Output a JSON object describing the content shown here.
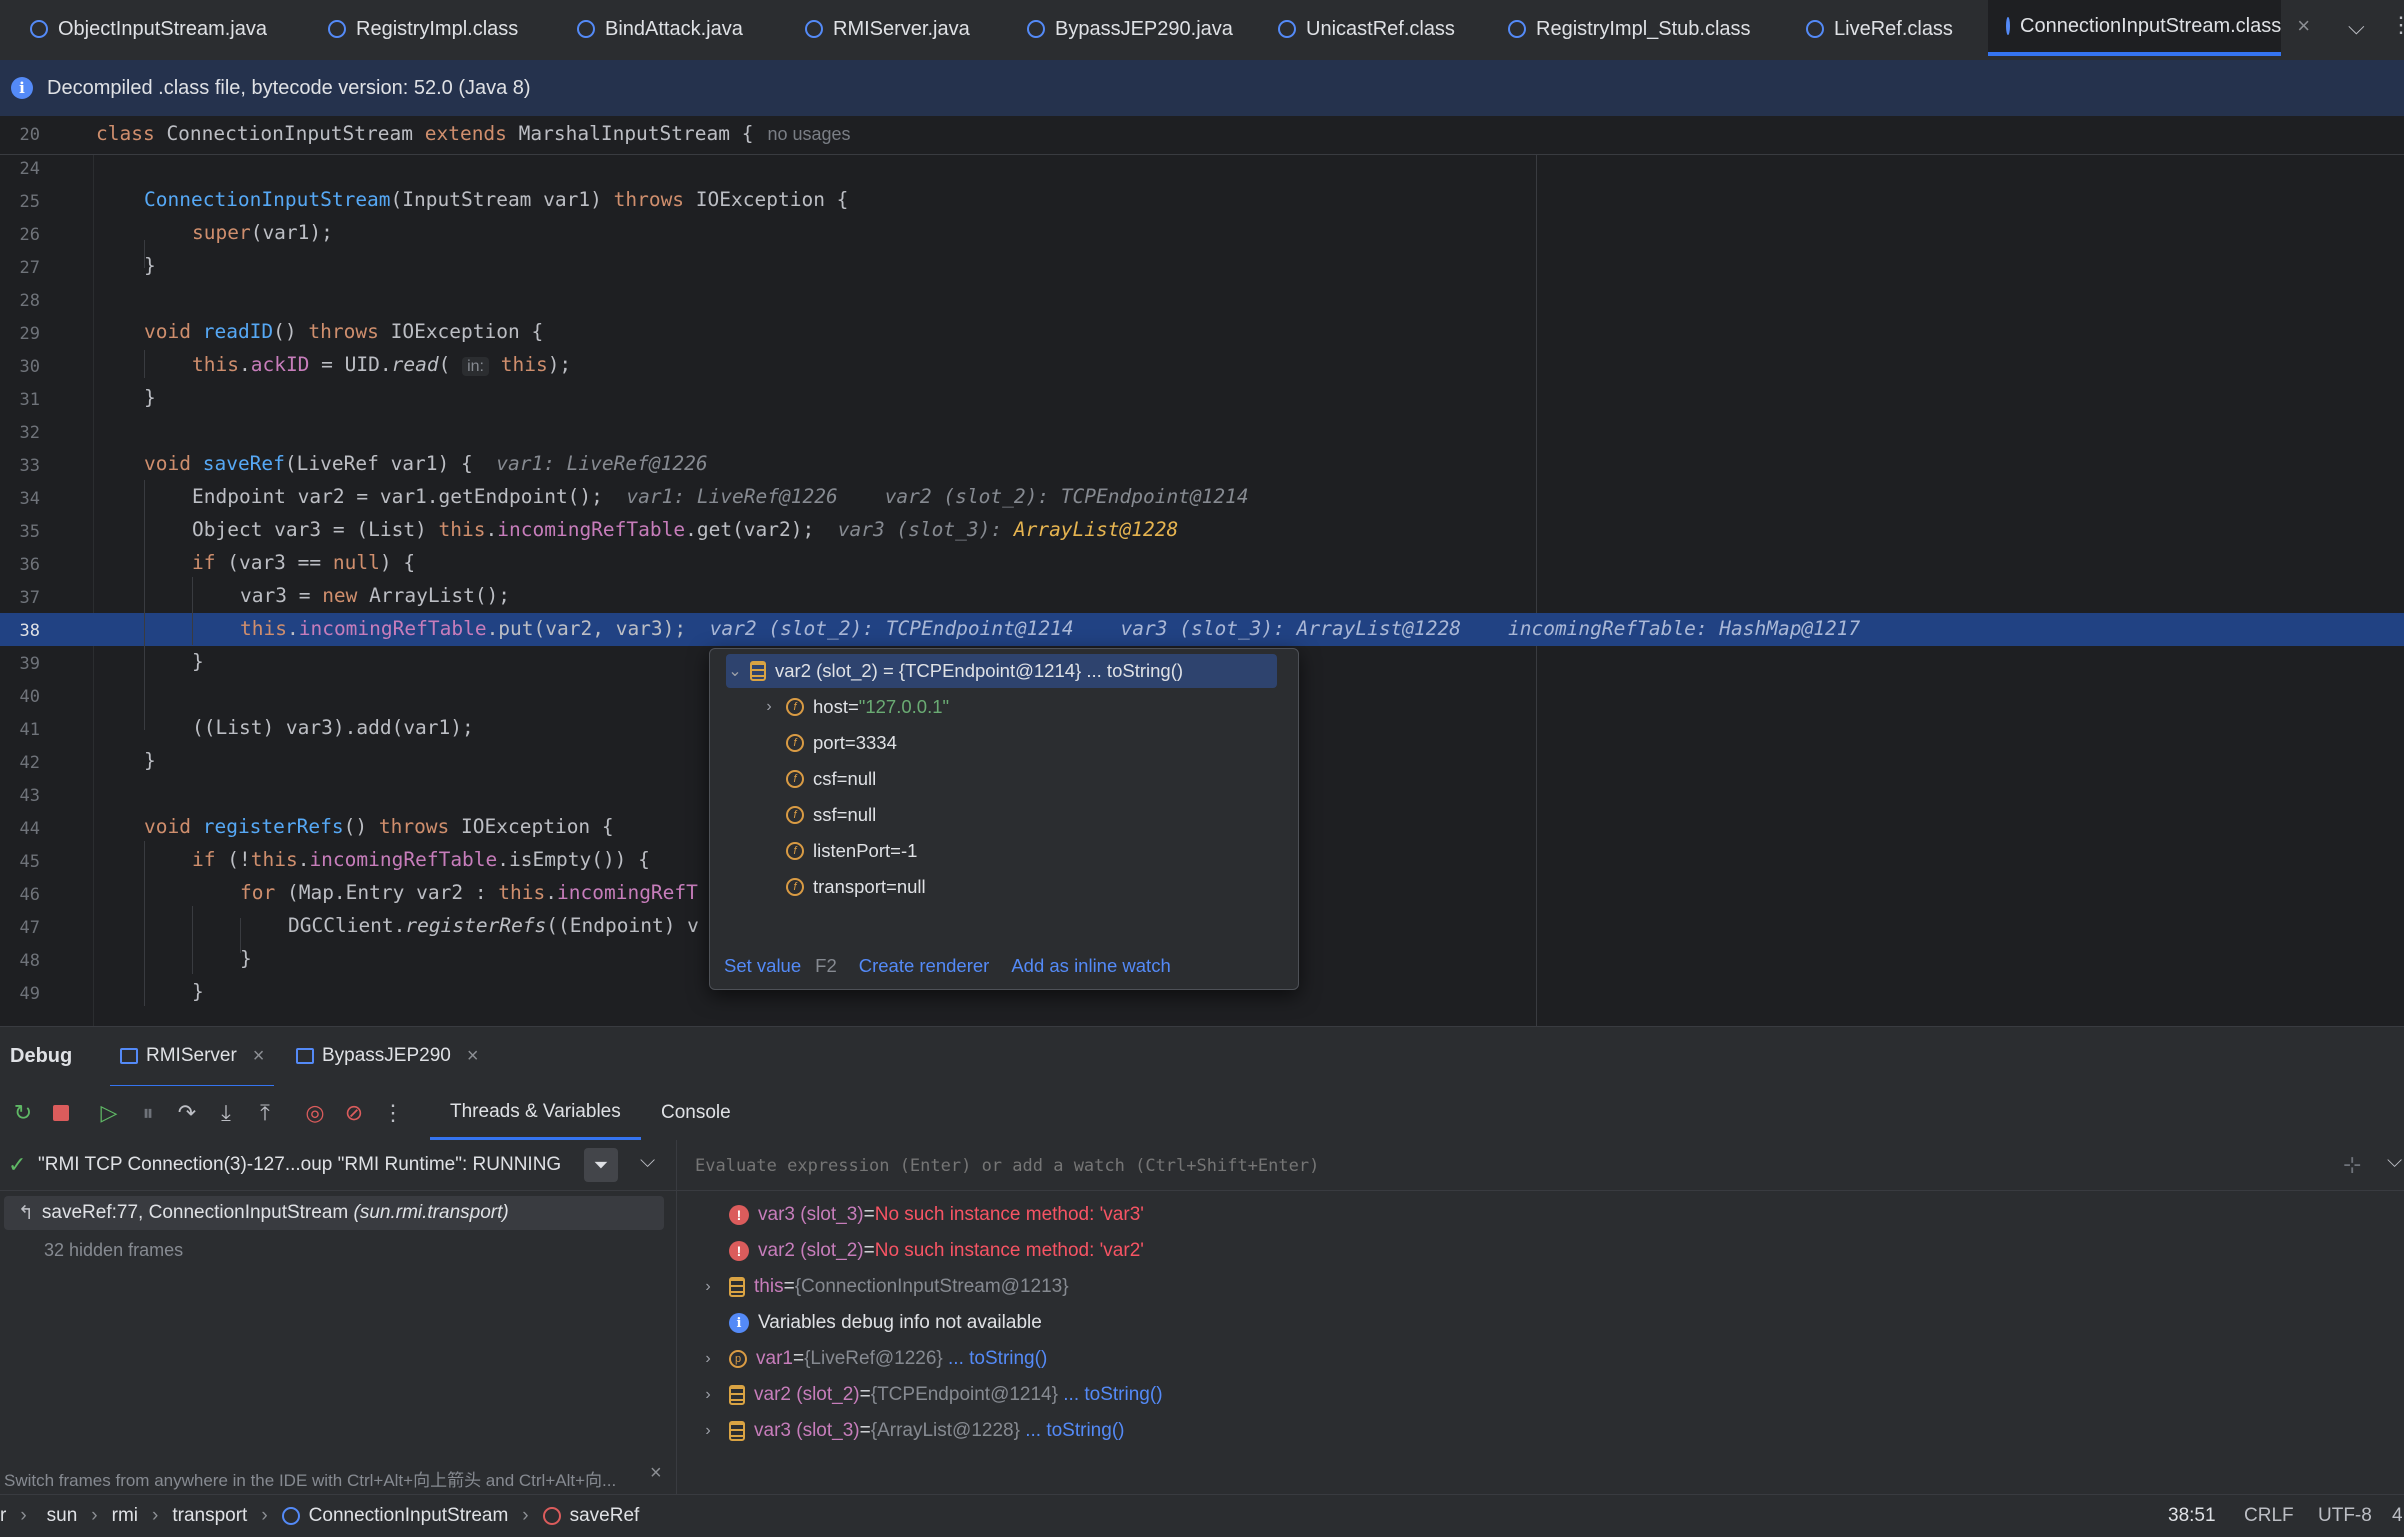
{
  "tabs": [
    {
      "label": "ObjectInputStream.java"
    },
    {
      "label": "RegistryImpl.class"
    },
    {
      "label": "BindAttack.java"
    },
    {
      "label": "RMIServer.java"
    },
    {
      "label": "BypassJEP290.java"
    },
    {
      "label": "UnicastRef.class"
    },
    {
      "label": "RegistryImpl_Stub.class"
    },
    {
      "label": "LiveRef.class"
    },
    {
      "label": "ConnectionInputStream.class"
    }
  ],
  "info_banner": "Decompiled .class file, bytecode version: 52.0 (Java 8)",
  "editor": {
    "sticky_line_number": "20",
    "sticky_no_usages": "no usages",
    "line_numbers": [
      "24",
      "25",
      "26",
      "27",
      "28",
      "29",
      "30",
      "31",
      "32",
      "33",
      "34",
      "35",
      "36",
      "37",
      "38",
      "39",
      "40",
      "41",
      "42",
      "43",
      "44",
      "45",
      "46",
      "47",
      "48",
      "49"
    ],
    "hints": {
      "l33": "var1: LiveRef@1226",
      "l34a": "var1: LiveRef@1226",
      "l34b": "var2 (slot_2): TCPEndpoint@1214",
      "l35a": "var3 (slot_3): ",
      "l35b": "ArrayList@1228",
      "l38a": "var2 (slot_2): TCPEndpoint@1214",
      "l38b": "var3 (slot_3): ArrayList@1228",
      "l38c": "incomingRefTable: HashMap@1217",
      "param_in": "in:"
    }
  },
  "popup": {
    "root": {
      "name": "var2 (slot_2) = {TCPEndpoint@1214}",
      "link": "... toString()"
    },
    "fields": [
      {
        "name": "host",
        "eq": " = ",
        "value": "\"127.0.0.1\""
      },
      {
        "name": "port",
        "eq": " = ",
        "value": "3334"
      },
      {
        "name": "csf",
        "eq": " = ",
        "value": "null"
      },
      {
        "name": "ssf",
        "eq": " = ",
        "value": "null"
      },
      {
        "name": "listenPort",
        "eq": " = ",
        "value": "-1"
      },
      {
        "name": "transport",
        "eq": " = ",
        "value": "null"
      }
    ],
    "footer": {
      "set_value": "Set value",
      "set_value_key": "F2",
      "create_renderer": "Create renderer",
      "add_watch": "Add as inline watch"
    }
  },
  "debug": {
    "title": "Debug",
    "sessions": [
      {
        "label": "RMIServer"
      },
      {
        "label": "BypassJEP290"
      }
    ],
    "tabs": {
      "threads": "Threads & Variables",
      "console": "Console"
    },
    "thread": "\"RMI TCP Connection(3)-127...oup \"RMI Runtime\": RUNNING",
    "frame": {
      "main": "saveRef:77, ConnectionInputStream",
      "pkg": "(sun.rmi.transport)"
    },
    "hidden_frames": "32 hidden frames",
    "eval_placeholder": "Evaluate expression (Enter) or add a watch (Ctrl+Shift+Enter)",
    "switch_hint": "Switch frames from anywhere in the IDE with Ctrl+Alt+向上箭头 and Ctrl+Alt+向...",
    "vars": [
      {
        "kind": "error",
        "name": "var3 (slot_3)",
        "eq": " = ",
        "value": "No such instance method: 'var3'"
      },
      {
        "kind": "error",
        "name": "var2 (slot_2)",
        "eq": " = ",
        "value": "No such instance method: 'var2'"
      },
      {
        "kind": "obj",
        "name": "this",
        "eq": " = ",
        "value": "{ConnectionInputStream@1213}",
        "link": ""
      },
      {
        "kind": "info",
        "name": "Variables debug info not available"
      },
      {
        "kind": "param",
        "name": "var1",
        "eq": " = ",
        "value": "{LiveRef@1226}",
        "link": "... toString()"
      },
      {
        "kind": "obj",
        "name": "var2 (slot_2)",
        "eq": " = ",
        "value": "{TCPEndpoint@1214}",
        "link": "... toString()"
      },
      {
        "kind": "obj",
        "name": "var3 (slot_3)",
        "eq": " = ",
        "value": "{ArrayList@1228}",
        "link": "... toString()"
      }
    ]
  },
  "statusbar": {
    "breadcrumbs": [
      "r",
      "sun",
      "rmi",
      "transport",
      "ConnectionInputStream",
      "saveRef"
    ],
    "position": "38:51",
    "line_sep": "CRLF",
    "encoding": "UTF-8",
    "indent": "4"
  },
  "colors": {
    "accent": "#3574f0",
    "highlight_line": "#214283",
    "error": "#f75464"
  }
}
